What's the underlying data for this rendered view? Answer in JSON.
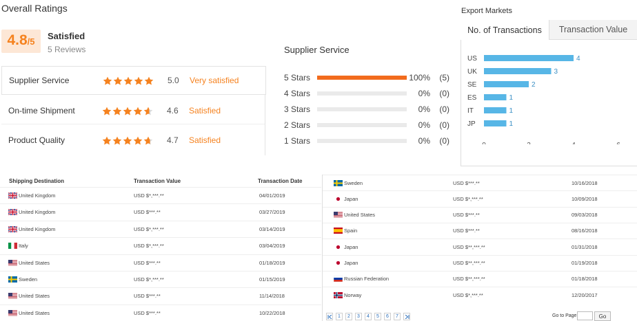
{
  "overall": {
    "title": "Overall Ratings",
    "score": "4.8",
    "score_suffix": "/5",
    "word": "Satisfied",
    "reviews": "5 Reviews"
  },
  "ratings": [
    {
      "label": "Supplier Service",
      "stars": 5,
      "score": "5.0",
      "word": "Very satisfied"
    },
    {
      "label": "On-time Shipment",
      "stars": 4.6,
      "score": "4.6",
      "word": "Satisfied"
    },
    {
      "label": "Product Quality",
      "stars": 4.7,
      "score": "4.7",
      "word": "Satisfied"
    }
  ],
  "colors": {
    "accent": "#f5821f",
    "bar_orange": "#f26b1d",
    "bar_blue": "#57b6e6",
    "link": "#2a6ebb"
  },
  "supplier_service": {
    "title": "Supplier Service",
    "rows": [
      {
        "label": "5 Stars",
        "pct": "100%",
        "count": "(5)",
        "fraction": 1.0
      },
      {
        "label": "4 Stars",
        "pct": "0%",
        "count": "(0)",
        "fraction": 0
      },
      {
        "label": "3 Stars",
        "pct": "0%",
        "count": "(0)",
        "fraction": 0
      },
      {
        "label": "2 Stars",
        "pct": "0%",
        "count": "(0)",
        "fraction": 0
      },
      {
        "label": "1 Stars",
        "pct": "0%",
        "count": "(0)",
        "fraction": 0
      }
    ]
  },
  "export_markets": {
    "title": "Export Markets",
    "tabs": [
      "No. of Transactions",
      "Transaction Value"
    ]
  },
  "chart_data": {
    "type": "bar",
    "orientation": "horizontal",
    "categories": [
      "US",
      "UK",
      "SE",
      "ES",
      "IT",
      "JP"
    ],
    "values": [
      4,
      3,
      2,
      1,
      1,
      1
    ],
    "xticks": [
      "0",
      "2",
      "4",
      "6"
    ],
    "xlim": [
      0,
      6
    ],
    "grid": false
  },
  "table": {
    "headers": [
      "Shipping Destination",
      "Transaction Value",
      "Transaction Date"
    ],
    "left_rows": [
      {
        "flag": "uk",
        "country": "United Kingdom",
        "value": "USD $*,***.**",
        "date": "04/01/2019"
      },
      {
        "flag": "uk",
        "country": "United Kingdom",
        "value": "USD $***.**",
        "date": "03/27/2019"
      },
      {
        "flag": "uk",
        "country": "United Kingdom",
        "value": "USD $*,***.**",
        "date": "03/14/2019"
      },
      {
        "flag": "it",
        "country": "Italy",
        "value": "USD $*,***.**",
        "date": "03/04/2019"
      },
      {
        "flag": "us",
        "country": "United States",
        "value": "USD $***.**",
        "date": "01/18/2019"
      },
      {
        "flag": "se",
        "country": "Sweden",
        "value": "USD $*,***.**",
        "date": "01/15/2019"
      },
      {
        "flag": "us",
        "country": "United States",
        "value": "USD $***.**",
        "date": "11/14/2018"
      },
      {
        "flag": "us",
        "country": "United States",
        "value": "USD $***.**",
        "date": "10/22/2018"
      }
    ],
    "right_rows": [
      {
        "flag": "se",
        "country": "Sweden",
        "value": "USD $***.**",
        "date": "10/16/2018"
      },
      {
        "flag": "jp",
        "country": "Japan",
        "value": "USD $*,***.**",
        "date": "10/09/2018"
      },
      {
        "flag": "us",
        "country": "United States",
        "value": "USD $***.**",
        "date": "09/03/2018"
      },
      {
        "flag": "es",
        "country": "Spain",
        "value": "USD $***.**",
        "date": "08/16/2018"
      },
      {
        "flag": "jp",
        "country": "Japan",
        "value": "USD $**,***.**",
        "date": "01/31/2018"
      },
      {
        "flag": "jp",
        "country": "Japan",
        "value": "USD $**,***.**",
        "date": "01/19/2018"
      },
      {
        "flag": "ru",
        "country": "Russian Federation",
        "value": "USD $**,***.**",
        "date": "01/18/2018"
      },
      {
        "flag": "no",
        "country": "Norway",
        "value": "USD $*,***.**",
        "date": "12/20/2017"
      }
    ]
  },
  "pagination": {
    "first_icon": "first-page-icon",
    "pages": [
      "1",
      "2",
      "3",
      "4",
      "5",
      "6",
      "7"
    ],
    "last_icon": "last-page-icon",
    "goto_label": "Go to Page",
    "go_button": "Go"
  }
}
